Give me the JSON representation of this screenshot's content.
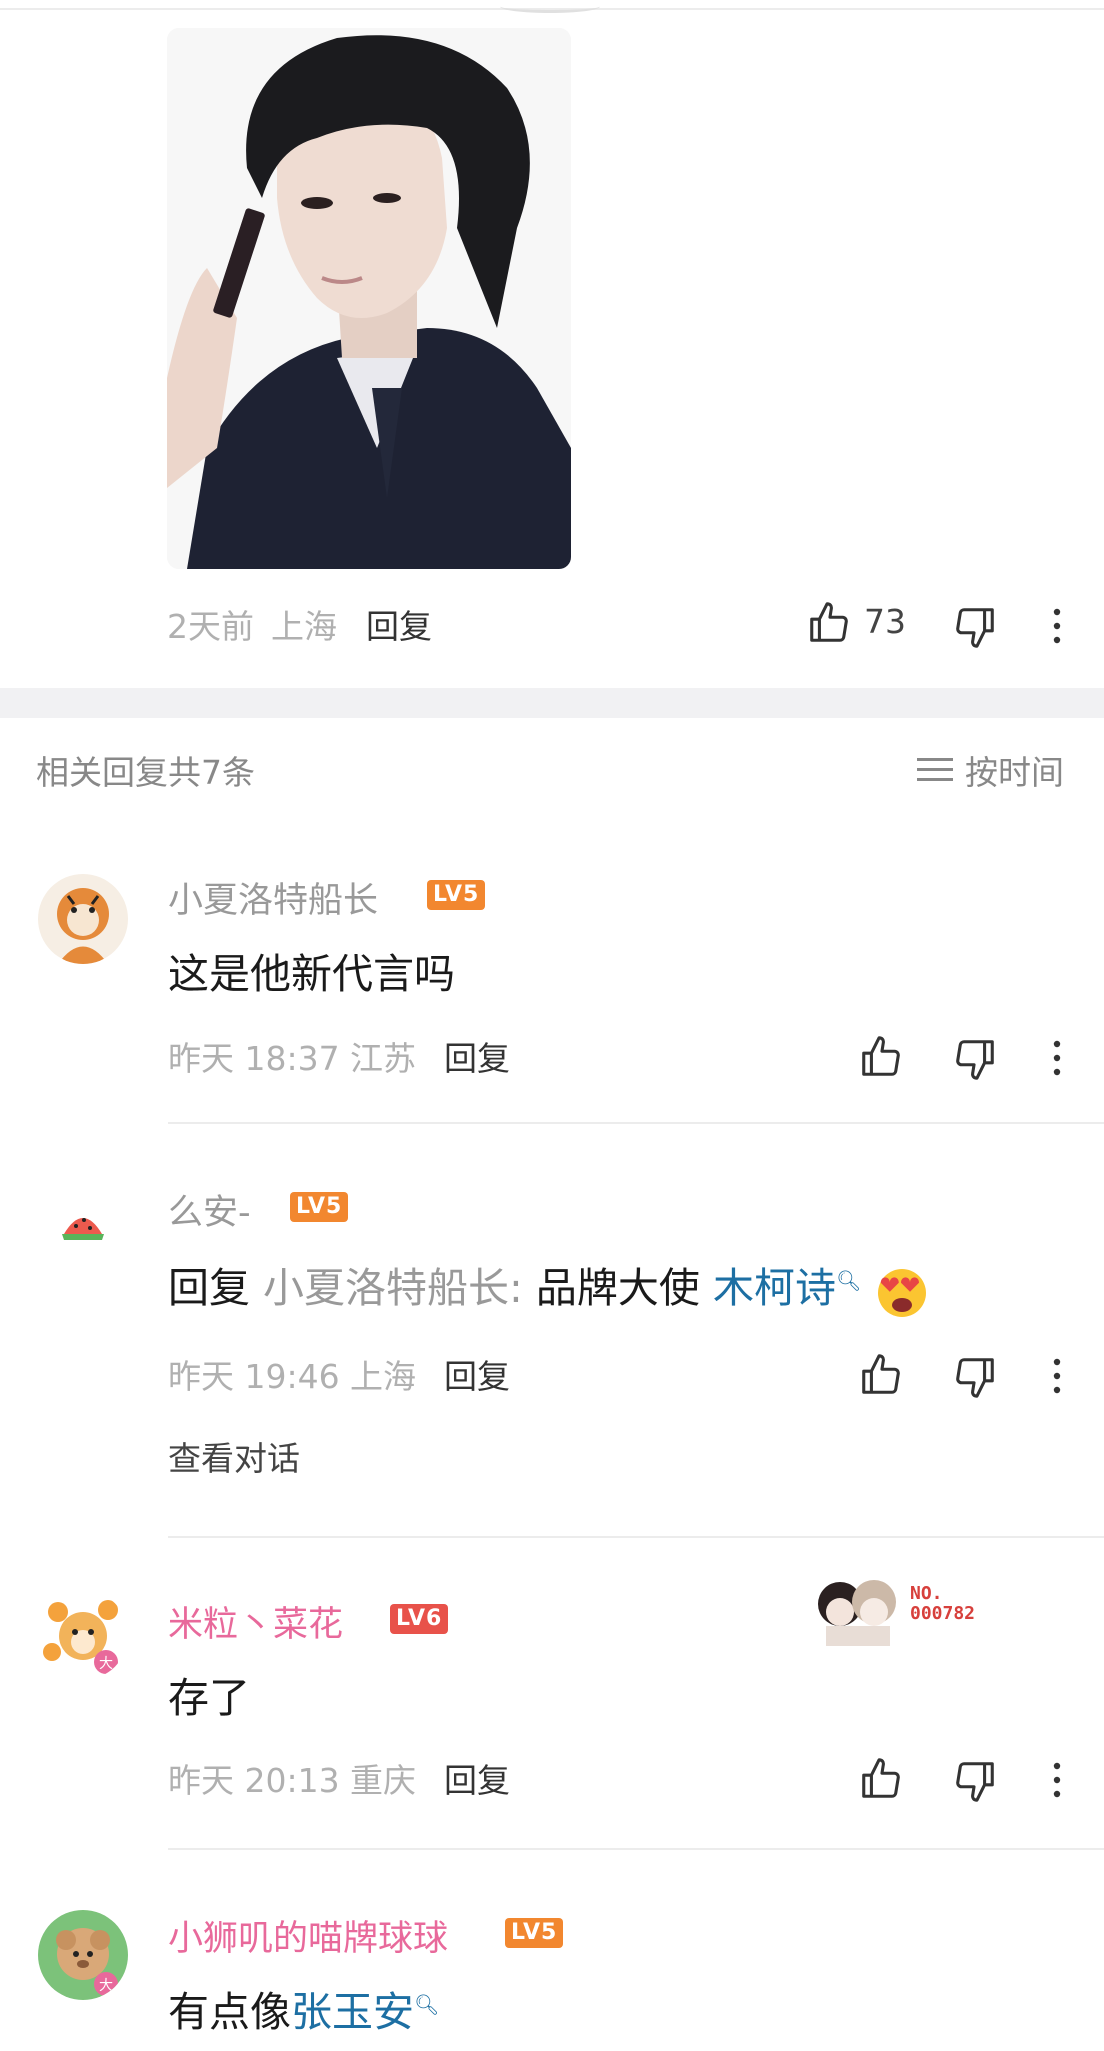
{
  "main_comment": {
    "time": "2天前",
    "location": "上海",
    "reply_label": "回复",
    "like_count": "73"
  },
  "replies_section": {
    "header": "相关回复共7条",
    "sort_label": "按时间"
  },
  "replies": [
    {
      "username": "小夏洛特船长",
      "level": "LV5",
      "text": "这是他新代言吗",
      "time": "昨天 18:37",
      "location": "江苏",
      "reply_label": "回复"
    },
    {
      "username": "么安-",
      "level": "LV5",
      "reply_prefix": "回复",
      "reply_target": "小夏洛特船长:",
      "text_before_link": "品牌大使",
      "link_text": "木柯诗",
      "emoji": "heart-eyes-emoji",
      "time": "昨天 19:46",
      "location": "上海",
      "reply_label": "回复",
      "view_conversation": "查看对话"
    },
    {
      "username": "米粒丶菜花",
      "level": "LV6",
      "text": "存了",
      "time": "昨天 20:13",
      "location": "重庆",
      "reply_label": "回复",
      "medal_line1": "NO.",
      "medal_line2": "000782"
    },
    {
      "username": "小狮叽的喵牌球球",
      "level": "LV5",
      "text_before_link": "有点像",
      "link_text": "张玉安"
    }
  ],
  "colors": {
    "link": "#1d6fa3",
    "vip_name": "#e8699b",
    "lv5_badge": "#f2872f",
    "lv6_badge": "#e8524a"
  }
}
